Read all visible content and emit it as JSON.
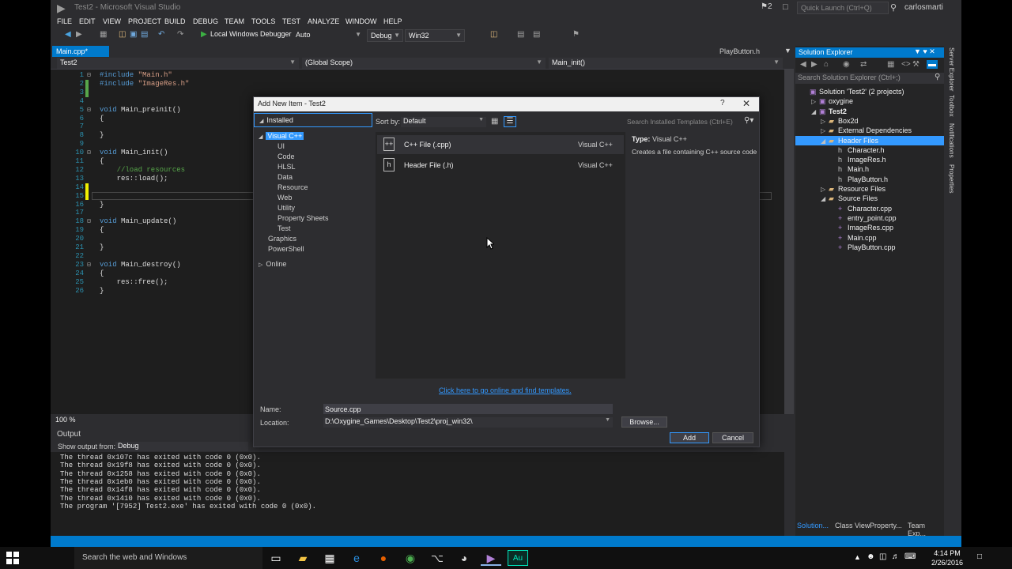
{
  "window": {
    "title": "Test2 - Microsoft Visual Studio",
    "notifications_count": "2",
    "quick_launch_placeholder": "Quick Launch (Ctrl+Q)",
    "user": "carlosmarti"
  },
  "menu": [
    "FILE",
    "EDIT",
    "VIEW",
    "PROJECT",
    "BUILD",
    "DEBUG",
    "TEAM",
    "TOOLS",
    "TEST",
    "ANALYZE",
    "WINDOW",
    "HELP"
  ],
  "toolbar": {
    "debugger_label": "Local Windows Debugger",
    "debugger_mode": "Auto",
    "config": "Debug",
    "platform": "Win32"
  },
  "editor": {
    "active_tab": "Main.cpp*",
    "other_tab": "PlayButton.h",
    "project_combo": "Test2",
    "scope_combo": "(Global Scope)",
    "member_combo": "Main_init()",
    "zoom": "100 %",
    "lines": [
      {
        "n": "1",
        "text": "#include \"Main.h\""
      },
      {
        "n": "2",
        "text": "#include \"ImageRes.h\""
      },
      {
        "n": "3",
        "text": ""
      },
      {
        "n": "4",
        "text": ""
      },
      {
        "n": "5",
        "text": "void Main_preinit()"
      },
      {
        "n": "6",
        "text": "{"
      },
      {
        "n": "7",
        "text": ""
      },
      {
        "n": "8",
        "text": "}"
      },
      {
        "n": "9",
        "text": ""
      },
      {
        "n": "10",
        "text": "void Main_init()"
      },
      {
        "n": "11",
        "text": "{"
      },
      {
        "n": "12",
        "text": "    //load resources"
      },
      {
        "n": "13",
        "text": "    res::load();"
      },
      {
        "n": "14",
        "text": ""
      },
      {
        "n": "15",
        "text": ""
      },
      {
        "n": "16",
        "text": "}"
      },
      {
        "n": "17",
        "text": ""
      },
      {
        "n": "18",
        "text": "void Main_update()"
      },
      {
        "n": "19",
        "text": "{"
      },
      {
        "n": "20",
        "text": ""
      },
      {
        "n": "21",
        "text": "}"
      },
      {
        "n": "22",
        "text": ""
      },
      {
        "n": "23",
        "text": "void Main_destroy()"
      },
      {
        "n": "24",
        "text": "{"
      },
      {
        "n": "25",
        "text": "    res::free();"
      },
      {
        "n": "26",
        "text": "}"
      }
    ]
  },
  "output": {
    "title": "Output",
    "show_from_label": "Show output from:",
    "show_from_value": "Debug",
    "lines": [
      "The thread 0x107c has exited with code 0 (0x0).",
      "The thread 0x19f8 has exited with code 0 (0x0).",
      "The thread 0x1258 has exited with code 0 (0x0).",
      "The thread 0x1eb0 has exited with code 0 (0x0).",
      "The thread 0x14f8 has exited with code 0 (0x0).",
      "The thread 0x1410 has exited with code 0 (0x0).",
      "The program '[7952] Test2.exe' has exited with code 0 (0x0)."
    ]
  },
  "solution_explorer": {
    "title": "Solution Explorer",
    "search_placeholder": "Search Solution Explorer (Ctrl+;)",
    "items": [
      {
        "label": "Solution 'Test2' (2 projects)",
        "level": 0,
        "expander": "",
        "icon": "solution-icon"
      },
      {
        "label": "oxygine",
        "level": 1,
        "expander": "▷",
        "icon": "project-icon"
      },
      {
        "label": "Test2",
        "level": 1,
        "expander": "◢",
        "icon": "project-icon",
        "bold": true
      },
      {
        "label": "Box2d",
        "level": 2,
        "expander": "▷",
        "icon": "filter-folder-icon"
      },
      {
        "label": "External Dependencies",
        "level": 2,
        "expander": "▷",
        "icon": "dependencies-icon"
      },
      {
        "label": "Header Files",
        "level": 2,
        "expander": "◢",
        "icon": "filter-folder-icon",
        "selected": true
      },
      {
        "label": "Character.h",
        "level": 3,
        "expander": "",
        "icon": "header-file-icon"
      },
      {
        "label": "ImageRes.h",
        "level": 3,
        "expander": "",
        "icon": "header-file-icon"
      },
      {
        "label": "Main.h",
        "level": 3,
        "expander": "",
        "icon": "header-file-icon"
      },
      {
        "label": "PlayButton.h",
        "level": 3,
        "expander": "",
        "icon": "header-file-icon"
      },
      {
        "label": "Resource Files",
        "level": 2,
        "expander": "▷",
        "icon": "filter-folder-icon"
      },
      {
        "label": "Source Files",
        "level": 2,
        "expander": "◢",
        "icon": "filter-folder-icon"
      },
      {
        "label": "Character.cpp",
        "level": 3,
        "expander": "",
        "icon": "cpp-file-icon"
      },
      {
        "label": "entry_point.cpp",
        "level": 3,
        "expander": "",
        "icon": "cpp-file-icon"
      },
      {
        "label": "ImageRes.cpp",
        "level": 3,
        "expander": "",
        "icon": "cpp-file-icon"
      },
      {
        "label": "Main.cpp",
        "level": 3,
        "expander": "",
        "icon": "cpp-file-icon"
      },
      {
        "label": "PlayButton.cpp",
        "level": 3,
        "expander": "",
        "icon": "cpp-file-icon"
      }
    ],
    "tabs": [
      "Solution...",
      "Class View",
      "Property...",
      "Team Exp..."
    ]
  },
  "right_rail": [
    "Server Explorer",
    "Toolbox",
    "Notifications",
    "Properties"
  ],
  "dialog": {
    "title": "Add New Item - Test2",
    "help": "?",
    "installed": "Installed",
    "categories": [
      {
        "label": "Visual C++",
        "level": 0,
        "expander": "◢",
        "selected": true
      },
      {
        "label": "UI",
        "level": 1
      },
      {
        "label": "Code",
        "level": 1
      },
      {
        "label": "HLSL",
        "level": 1
      },
      {
        "label": "Data",
        "level": 1
      },
      {
        "label": "Resource",
        "level": 1
      },
      {
        "label": "Web",
        "level": 1
      },
      {
        "label": "Utility",
        "level": 1
      },
      {
        "label": "Property Sheets",
        "level": 1
      },
      {
        "label": "Test",
        "level": 1
      },
      {
        "label": "Graphics",
        "level": 0
      },
      {
        "label": "PowerShell",
        "level": 0
      }
    ],
    "online": "Online",
    "sort_label": "Sort by:",
    "sort_value": "Default",
    "search_placeholder": "Search Installed Templates (Ctrl+E)",
    "templates": [
      {
        "name": "C++ File (.cpp)",
        "lang": "Visual C++",
        "icon_text": "++"
      },
      {
        "name": "Header File (.h)",
        "lang": "Visual C++",
        "icon_text": "h"
      }
    ],
    "desc_type_label": "Type:",
    "desc_type": "Visual C++",
    "desc_text": "Creates a file containing C++ source code",
    "online_link": "Click here to go online and find templates.",
    "name_label": "Name:",
    "name_value": "Source.cpp",
    "location_label": "Location:",
    "location_value": "D:\\Oxygine_Games\\Desktop\\Test2\\proj_win32\\",
    "browse": "Browse...",
    "add": "Add",
    "cancel": "Cancel"
  },
  "taskbar": {
    "search_placeholder": "Search the web and Windows",
    "time": "4:14 PM",
    "date": "2/26/2016",
    "apps": [
      "task-view-icon",
      "file-explorer-icon",
      "store-icon",
      "edge-icon",
      "firefox-icon",
      "chrome-icon",
      "git-icon",
      "paint-icon",
      "visual-studio-icon",
      "audition-icon"
    ]
  },
  "colors": {
    "accent": "#007acc",
    "selection": "#3399ff",
    "editor_bg": "#1e1e1e",
    "chrome_bg": "#2d2d30"
  }
}
